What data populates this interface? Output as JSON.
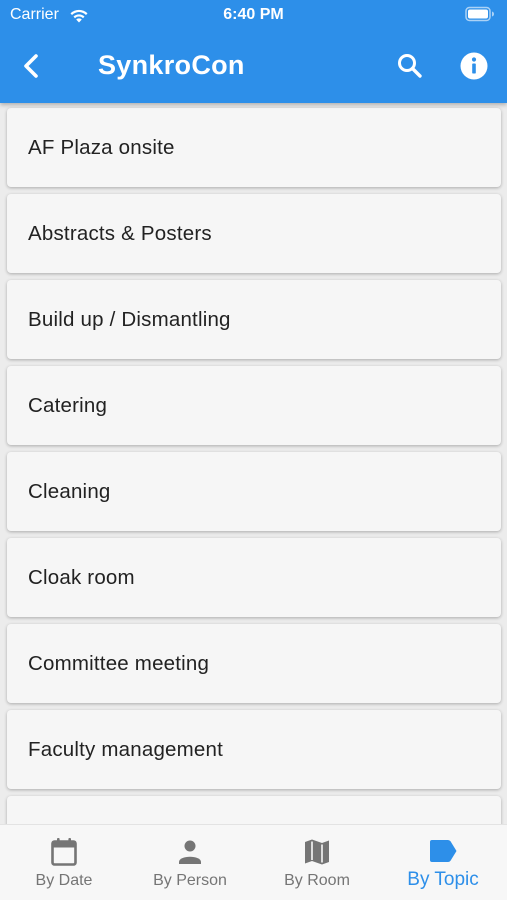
{
  "status_bar": {
    "carrier": "Carrier",
    "time": "6:40 PM"
  },
  "app_bar": {
    "title": "SynkroCon",
    "back_icon": "chevron-left-icon",
    "search_icon": "search-icon",
    "info_icon": "info-icon",
    "color": "#2d8fe9"
  },
  "topics": [
    {
      "label": "AF Plaza onsite"
    },
    {
      "label": "Abstracts & Posters"
    },
    {
      "label": "Build up / Dismantling"
    },
    {
      "label": "Catering"
    },
    {
      "label": "Cleaning"
    },
    {
      "label": "Cloak room"
    },
    {
      "label": "Committee meeting"
    },
    {
      "label": "Faculty management"
    },
    {
      "label": ""
    }
  ],
  "bottom_nav": {
    "tabs": [
      {
        "label": "By Date",
        "icon": "calendar-icon",
        "active": false
      },
      {
        "label": "By Person",
        "icon": "person-icon",
        "active": false
      },
      {
        "label": "By Room",
        "icon": "map-icon",
        "active": false
      },
      {
        "label": "By Topic",
        "icon": "label-tag-icon",
        "active": true
      }
    ],
    "active_color": "#2d8fe9",
    "inactive_color": "#757575"
  }
}
